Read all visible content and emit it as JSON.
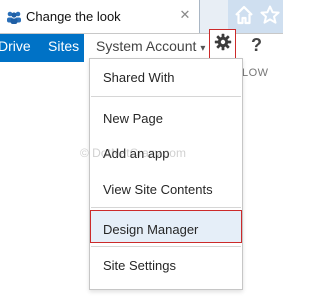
{
  "browser": {
    "tab_title": "Change the look",
    "close_glyph": "✕",
    "home_icon": "home-icon",
    "star_icon": "star-icon"
  },
  "suitebar": {
    "nav_links": [
      "Drive",
      "Sites"
    ],
    "account_label": "System Account",
    "account_caret": "▾",
    "help_label": "?",
    "follow_fragment": "LOW"
  },
  "settings_menu": {
    "items": [
      "Shared With",
      "New Page",
      "Add an app",
      "View Site Contents",
      "Design Manager",
      "Site Settings"
    ],
    "highlighted_item": "Design Manager"
  },
  "watermark": "© DotNetCrazy.com",
  "colors": {
    "suite_blue": "#0072c6",
    "highlight_border": "#cc2a2a",
    "highlight_fill": "#e5eef8"
  }
}
